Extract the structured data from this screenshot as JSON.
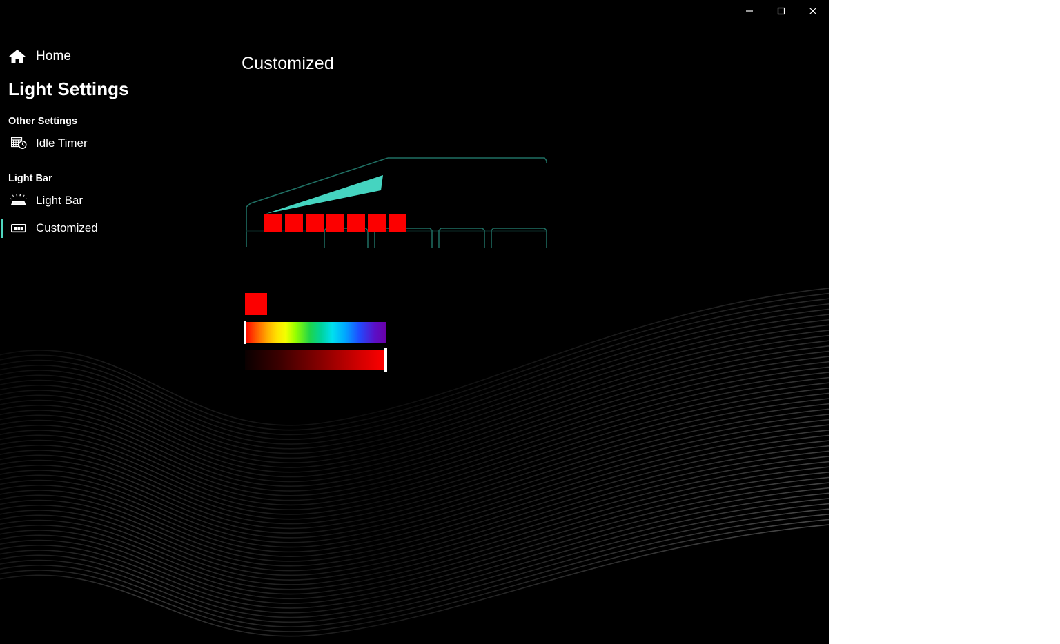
{
  "window": {
    "titlebar_buttons": [
      {
        "name": "minimize",
        "label": "–"
      },
      {
        "name": "maximize",
        "label": "☐"
      },
      {
        "name": "close",
        "label": "✕"
      }
    ]
  },
  "sidebar": {
    "home_label": "Home",
    "home_icon": "home-icon",
    "app_heading": "Light Settings",
    "groups": [
      {
        "header": "Other Settings",
        "items": [
          {
            "label": "Idle Timer",
            "icon": "idle-timer-icon",
            "selected": false
          }
        ]
      },
      {
        "header": "Light Bar",
        "items": [
          {
            "label": "Light Bar",
            "icon": "light-bar-icon",
            "selected": false
          },
          {
            "label": "Customized",
            "icon": "customized-icon",
            "selected": true
          }
        ]
      }
    ]
  },
  "main": {
    "page_title": "Customized",
    "diagram": {
      "name": "keyboard-light-bar-diagram",
      "outline_color": "#1f6f63",
      "accent_color": "#45d4c0",
      "zones": [
        {
          "index": 1,
          "color": "#fc0000"
        },
        {
          "index": 2,
          "color": "#fc0000"
        },
        {
          "index": 3,
          "color": "#fc0000"
        },
        {
          "index": 4,
          "color": "#fc0000"
        },
        {
          "index": 5,
          "color": "#fc0000"
        },
        {
          "index": 6,
          "color": "#fc0000"
        },
        {
          "index": 7,
          "color": "#fc0000"
        }
      ]
    },
    "color_picker": {
      "current_color": "#fc0000",
      "hue_slider": {
        "name": "hue-slider",
        "value_percent": 0,
        "thumb_position_percent": 0
      },
      "brightness_slider": {
        "name": "brightness-slider",
        "value_percent": 100,
        "thumb_position_percent": 100
      }
    }
  }
}
